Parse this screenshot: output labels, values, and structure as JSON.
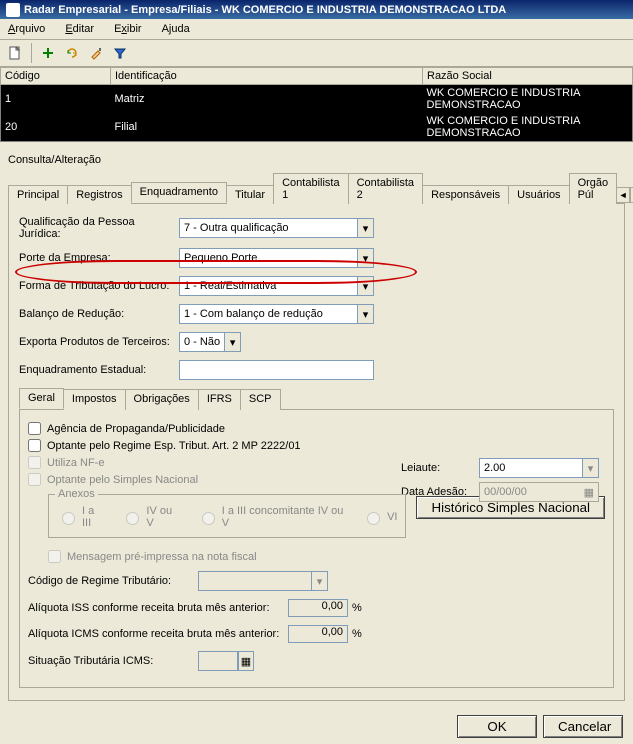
{
  "title": "Radar Empresarial - Empresa/Filiais - WK COMERCIO E INDUSTRIA DEMONSTRACAO LTDA",
  "menu": {
    "arquivo": "Arquivo",
    "editar": "Editar",
    "exibir": "Exibir",
    "ajuda": "Ajuda"
  },
  "grid": {
    "headers": {
      "codigo": "Código",
      "identificacao": "Identificação",
      "razao": "Razão Social"
    },
    "rows": [
      {
        "codigo": "1",
        "identificacao": "Matriz",
        "razao": "WK COMERCIO E INDUSTRIA DEMONSTRACAO"
      },
      {
        "codigo": "20",
        "identificacao": "Filial",
        "razao": "WK COMERCIO E INDUSTRIA DEMONSTRACAO"
      }
    ]
  },
  "sectionTitle": "Consulta/Alteração",
  "tabs": {
    "principal": "Principal",
    "registros": "Registros",
    "enquadramento": "Enquadramento",
    "titular": "Titular",
    "contabilista1": "Contabilista 1",
    "contabilista2": "Contabilista 2",
    "responsaveis": "Responsáveis",
    "usuarios": "Usuários",
    "orgao": "Orgão Púl"
  },
  "fields": {
    "qualificacao": {
      "label": "Qualificação da Pessoa Jurídica:",
      "value": "7 - Outra qualificação"
    },
    "porte": {
      "label": "Porte da Empresa:",
      "value": "Pequeno Porte"
    },
    "tributacao": {
      "label": "Forma de Tributação do Lucro:",
      "value": "1 - Real/Estimativa"
    },
    "balanco": {
      "label": "Balanço de Redução:",
      "value": "1 - Com balanço de redução"
    },
    "exporta": {
      "label": "Exporta Produtos de Terceiros:",
      "value": "0 - Não"
    },
    "estadual": {
      "label": "Enquadramento Estadual:",
      "value": ""
    }
  },
  "innerTabs": {
    "geral": "Geral",
    "impostos": "Impostos",
    "obrigacoes": "Obrigações",
    "ifrs": "IFRS",
    "scp": "SCP"
  },
  "checks": {
    "agencia": "Agência de Propaganda/Publicidade",
    "optanteRegime": "Optante pelo Regime Esp. Tribut. Art. 2 MP 2222/01",
    "nfe": "Utiliza NF-e",
    "simples": "Optante pelo Simples Nacional",
    "mensagem": "Mensagem pré-impressa na nota fiscal"
  },
  "anexos": {
    "title": "Anexos",
    "r1": "I a III",
    "r2": "IV ou V",
    "r3": "I a III concomitante IV ou V",
    "r4": "VI"
  },
  "right": {
    "leiauteLabel": "Leiaute:",
    "leiauteValue": "2.00",
    "dataAdesaoLabel": "Data Adesão:",
    "dataAdesaoValue": "00/00/00",
    "historicoBtn": "Histórico Simples Nacional"
  },
  "bottom": {
    "codigoRegimeLabel": "Código de Regime Tributário:",
    "codigoRegimeValue": "",
    "issLabel": "Alíquota ISS conforme receita bruta mês anterior:",
    "issValue": "0,00",
    "percent": "%",
    "icmsLabel": "Alíquota ICMS conforme receita bruta mês anterior:",
    "icmsValue": "0,00",
    "situacaoLabel": "Situação Tributária ICMS:",
    "situacaoValue": ""
  },
  "footer": {
    "ok": "OK",
    "cancelar": "Cancelar"
  }
}
